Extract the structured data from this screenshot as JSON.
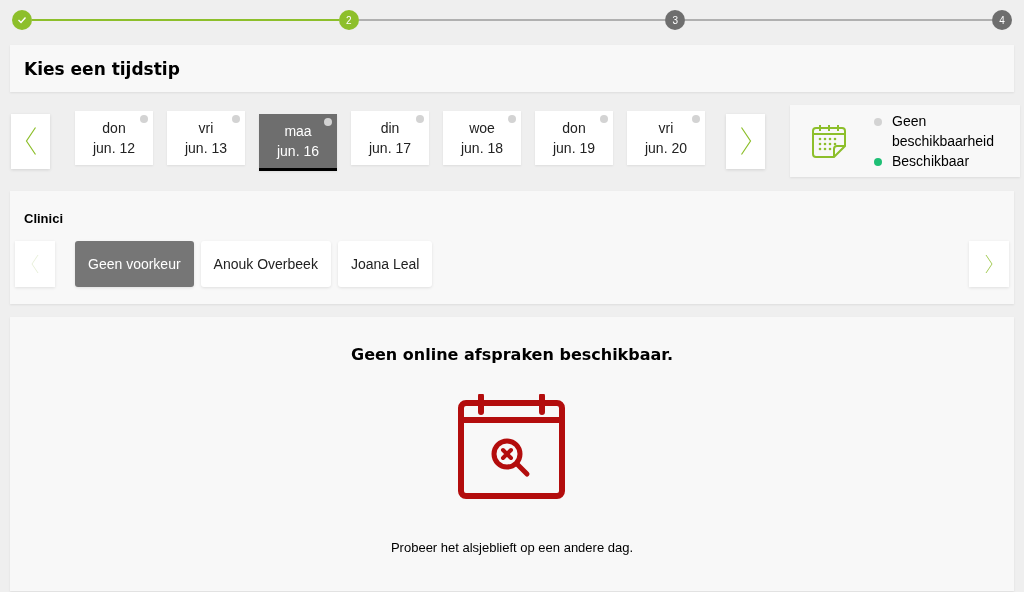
{
  "steps": [
    {
      "done": true,
      "selected": false
    },
    {
      "label": "2",
      "done": false,
      "selected": true
    },
    {
      "label": "3",
      "done": false,
      "selected": false
    },
    {
      "label": "4",
      "done": false,
      "selected": false
    }
  ],
  "title": "Kies een tijdstip",
  "days": [
    {
      "weekday": "don",
      "date": "jun. 12",
      "selected": false,
      "color": "#d3d3d3"
    },
    {
      "weekday": "vri",
      "date": "jun. 13",
      "selected": false,
      "color": "#d3d3d3"
    },
    {
      "weekday": "maa",
      "date": "jun. 16",
      "selected": true,
      "color": "#d3d3d3"
    },
    {
      "weekday": "din",
      "date": "jun. 17",
      "selected": false,
      "color": "#d3d3d3"
    },
    {
      "weekday": "woe",
      "date": "jun. 18",
      "selected": false,
      "color": "#d3d3d3"
    },
    {
      "weekday": "don",
      "date": "jun. 19",
      "selected": false,
      "color": "#d3d3d3"
    },
    {
      "weekday": "vri",
      "date": "jun. 20",
      "selected": false,
      "color": "#d3d3d3"
    }
  ],
  "legend": [
    {
      "label": "Geen beschikbaarheid",
      "color": "#d3d3d3"
    },
    {
      "label": "Beschikbaar",
      "color": "#1fbf75"
    }
  ],
  "clinicians": {
    "heading": "Clinici",
    "prev_disabled": true,
    "items": [
      {
        "label": "Geen voorkeur",
        "selected": true
      },
      {
        "label": "Anouk Overbeek",
        "selected": false
      },
      {
        "label": "Joana Leal",
        "selected": false
      }
    ]
  },
  "empty": {
    "heading": "Geen online afspraken beschikbaar.",
    "message": "Probeer het alsjeblieft op een andere dag."
  }
}
